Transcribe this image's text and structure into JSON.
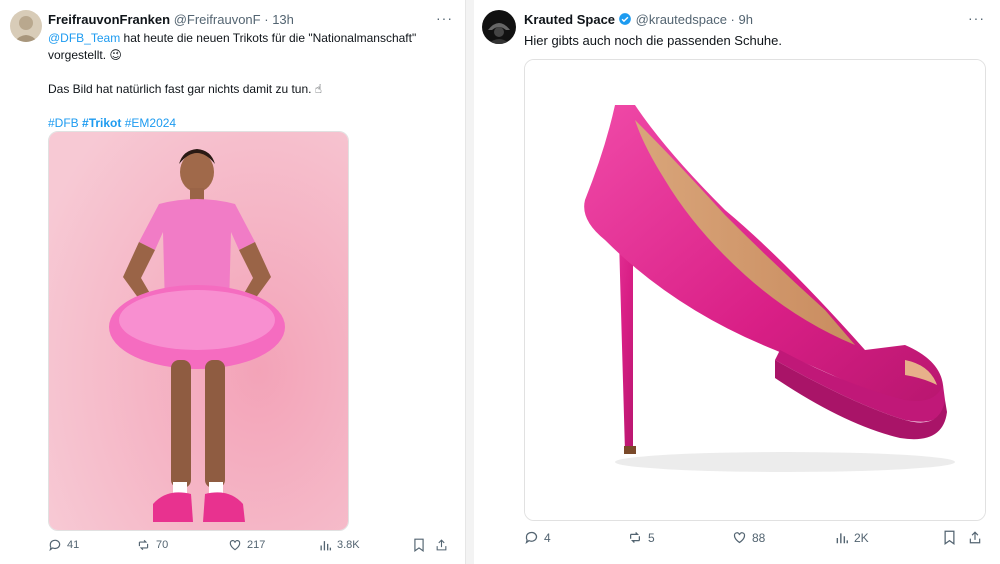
{
  "tweets": [
    {
      "name": "FreifrauvonFranken",
      "handle": "@FreifrauvonF",
      "separator": "·",
      "time": "13h",
      "more": "···",
      "line1_mention": "@DFB_Team",
      "line1_text": " hat heute die neuen Trikots für die \"Nationalmanschaft\"",
      "line2_text": "vorgestellt. 😉",
      "line3_text": "Das Bild hat natürlich fast gar nichts damit zu tun. ☝",
      "hashtag1": "#DFB",
      "hashtag2": "#Trikot",
      "hashtag3": "#EM2024",
      "actions": {
        "replies": "41",
        "reposts": "70",
        "likes": "217",
        "views": "3.8K"
      },
      "colors": {
        "hashtag_link": "#1d9bf0",
        "avatar": "#c8b9a6"
      }
    },
    {
      "name": "Krauted Space",
      "handle": "@krautedspace",
      "separator": "·",
      "time": "9h",
      "more": "···",
      "text": "Hier gibts auch noch die passenden Schuhe.",
      "actions": {
        "replies": "4",
        "reposts": "5",
        "likes": "88",
        "views": "2K"
      },
      "colors": {
        "verified": "#1d9bf0",
        "shoe": "#e0248e"
      }
    }
  ]
}
